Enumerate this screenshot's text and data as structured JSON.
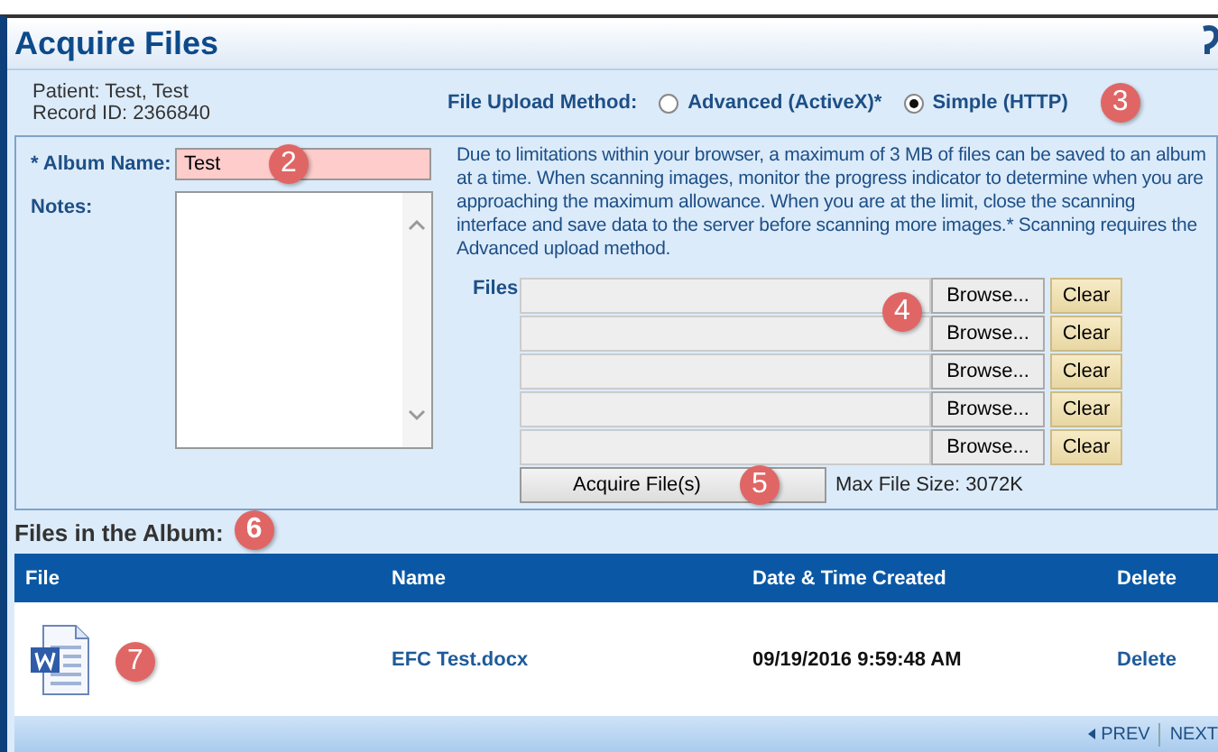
{
  "title": "Acquire Files",
  "patient": "Patient: Test, Test",
  "record_id": "Record ID: 2366840",
  "upload_method": {
    "label": "File Upload Method:",
    "options": [
      {
        "label": "Advanced (ActiveX)*",
        "selected": false
      },
      {
        "label": "Simple (HTTP)",
        "selected": true
      }
    ],
    "callout": "3"
  },
  "album_name": {
    "label": "* Album Name:",
    "value": "Test",
    "callout": "2"
  },
  "notes": {
    "label": "Notes:"
  },
  "info_text": "Due to limitations within your browser, a maximum of 3 MB of files can be saved to an album at a time. When scanning images, monitor the progress indicator to determine when you are approaching the maximum allowance. When you are at the limit, close the scanning interface and save data to the server before scanning more images.* Scanning requires the Advanced upload method.",
  "files": {
    "label": "Files",
    "callout": "4",
    "rows": [
      {
        "browse": "Browse...",
        "clear": "Clear"
      },
      {
        "browse": "Browse...",
        "clear": "Clear"
      },
      {
        "browse": "Browse...",
        "clear": "Clear"
      },
      {
        "browse": "Browse...",
        "clear": "Clear"
      },
      {
        "browse": "Browse...",
        "clear": "Clear"
      }
    ]
  },
  "acquire_button": {
    "label": "Acquire File(s)",
    "callout": "5"
  },
  "max_file_size": "Max File Size: 3072K",
  "album": {
    "heading": "Files in the Album:",
    "heading_callout": "6",
    "columns": [
      "File",
      "Name",
      "Date & Time Created",
      "Delete"
    ],
    "rows": [
      {
        "icon_callout": "7",
        "name": "EFC Test.docx",
        "created": "09/19/2016 9:59:48 AM",
        "delete": "Delete"
      }
    ]
  },
  "pager": {
    "prev": "PREV",
    "next": "NEXT"
  }
}
